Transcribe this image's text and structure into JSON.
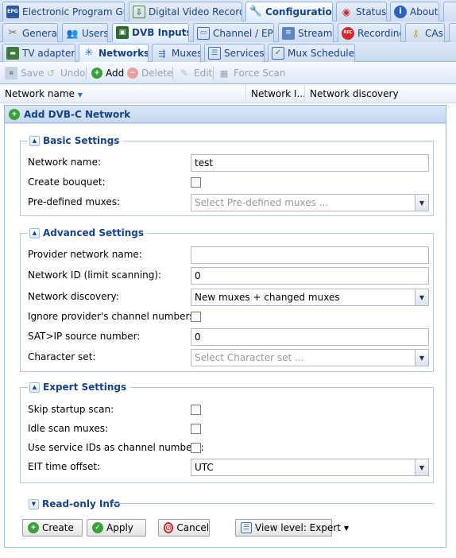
{
  "top_tabs": [
    {
      "label": "Electronic Program Guide",
      "icon": "epg-icon"
    },
    {
      "label": "Digital Video Recorder",
      "icon": "download-icon"
    },
    {
      "label": "Configuration",
      "icon": "wrench-icon",
      "active": true
    },
    {
      "label": "Status",
      "icon": "eye-icon"
    },
    {
      "label": "About",
      "icon": "info-icon"
    }
  ],
  "config_tabs": [
    {
      "label": "General",
      "icon": "tools-icon"
    },
    {
      "label": "Users",
      "icon": "users-icon"
    },
    {
      "label": "DVB Inputs",
      "icon": "tv-icon",
      "active": true
    },
    {
      "label": "Channel / EPG",
      "icon": "television-icon"
    },
    {
      "label": "Stream",
      "icon": "stream-icon"
    },
    {
      "label": "Recording",
      "icon": "rec-icon"
    },
    {
      "label": "CAs",
      "icon": "key-icon"
    }
  ],
  "dvb_tabs": [
    {
      "label": "TV adapters",
      "icon": "adapter-icon"
    },
    {
      "label": "Networks",
      "icon": "antenna-icon",
      "active": true
    },
    {
      "label": "Muxes",
      "icon": "muxes-icon"
    },
    {
      "label": "Services",
      "icon": "services-icon"
    },
    {
      "label": "Mux Schedulers",
      "icon": "scheduler-icon"
    }
  ],
  "toolbar": {
    "save": "Save",
    "undo": "Undo",
    "add": "Add",
    "delete": "Delete",
    "edit": "Edit",
    "force_scan": "Force Scan"
  },
  "grid": {
    "columns": [
      "Network name",
      "Network I...",
      "Network discovery"
    ]
  },
  "dialog": {
    "title": "Add DVB-C Network",
    "basic": {
      "legend": "Basic Settings",
      "network_name_label": "Network name:",
      "network_name_value": "test",
      "create_bouquet_label": "Create bouquet:",
      "predefined_label": "Pre-defined muxes:",
      "predefined_placeholder": "Select Pre-defined muxes ..."
    },
    "advanced": {
      "legend": "Advanced Settings",
      "provider_label": "Provider network name:",
      "provider_value": "",
      "network_id_label": "Network ID (limit scanning):",
      "network_id_value": "0",
      "discovery_label": "Network discovery:",
      "discovery_value": "New muxes + changed muxes",
      "ignore_label": "Ignore provider's channel numbers:",
      "satip_label": "SAT>IP source number:",
      "satip_value": "0",
      "charset_label": "Character set:",
      "charset_placeholder": "Select Character set ..."
    },
    "expert": {
      "legend": "Expert Settings",
      "skip_label": "Skip startup scan:",
      "idle_label": "Idle scan muxes:",
      "service_ids_label": "Use service IDs as channel numbers:",
      "eit_label": "EIT time offset:",
      "eit_value": "UTC"
    },
    "readonly": {
      "legend": "Read-only Info"
    },
    "buttons": {
      "create": "Create",
      "apply": "Apply",
      "cancel": "Cancel",
      "view_level": "View level: Expert"
    }
  },
  "colors": {
    "accent": "#15428b",
    "border": "#99bbe8",
    "panel_bg": "#dfe8f6"
  }
}
